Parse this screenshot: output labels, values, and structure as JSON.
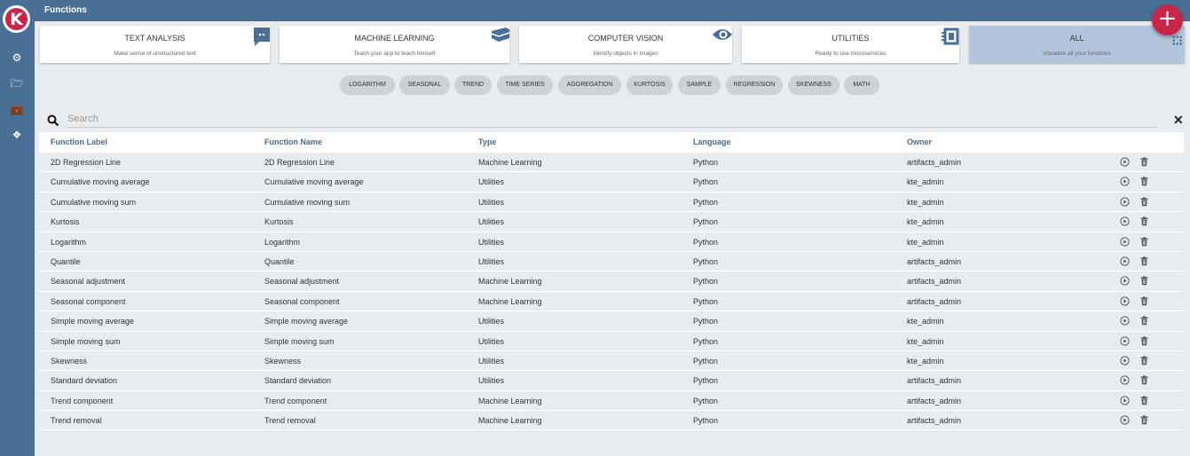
{
  "app": {
    "logo_letter": "K",
    "title": "Functions",
    "add_label": "+"
  },
  "sidebar": {
    "items": [
      {
        "icon": "gear-icon",
        "glyph": "⚙"
      },
      {
        "icon": "folder-open-icon",
        "glyph": "🗁"
      },
      {
        "icon": "briefcase-icon",
        "glyph": "💼"
      },
      {
        "icon": "cubes-icon",
        "glyph": "❖"
      }
    ]
  },
  "categories": [
    {
      "title": "TEXT ANALYSIS",
      "subtitle": "Make sense of unstructured text",
      "icon": "comment-icon"
    },
    {
      "title": "MACHINE LEARNING",
      "subtitle": "Teach your app to teach himself",
      "icon": "graduation-cap-icon"
    },
    {
      "title": "COMPUTER VISION",
      "subtitle": "Identify objects in images",
      "icon": "eye-icon"
    },
    {
      "title": "UTILITIES",
      "subtitle": "Ready to use microservices",
      "icon": "chip-icon"
    },
    {
      "title": "ALL",
      "subtitle": "Visualize all your functions",
      "icon": "grid-icon"
    }
  ],
  "tags": [
    "LOGARITHM",
    "SEASONAL",
    "TREND",
    "TIME SERIES",
    "AGGREGATION",
    "KURTOSIS",
    "SAMPLE",
    "REGRESSION",
    "SKEWNESS",
    "MATH"
  ],
  "search": {
    "placeholder": "Search",
    "value": ""
  },
  "table": {
    "columns": [
      "Function Label",
      "Function Name",
      "Type",
      "Language",
      "Owner"
    ],
    "rows": [
      [
        "2D Regression Line",
        "2D Regression Line",
        "Machine Learning",
        "Python",
        "artifacts_admin"
      ],
      [
        "Cumulative moving average",
        "Cumulative moving average",
        "Utilities",
        "Python",
        "kte_admin"
      ],
      [
        "Cumulative moving sum",
        "Cumulative moving sum",
        "Utilities",
        "Python",
        "kte_admin"
      ],
      [
        "Kurtosis",
        "Kurtosis",
        "Utilities",
        "Python",
        "kte_admin"
      ],
      [
        "Logarithm",
        "Logarithm",
        "Utilities",
        "Python",
        "kte_admin"
      ],
      [
        "Quantile",
        "Quantile",
        "Utilities",
        "Python",
        "artifacts_admin"
      ],
      [
        "Seasonal adjustment",
        "Seasonal adjustment",
        "Machine Learning",
        "Python",
        "artifacts_admin"
      ],
      [
        "Seasonal component",
        "Seasonal component",
        "Machine Learning",
        "Python",
        "artifacts_admin"
      ],
      [
        "Simple moving average",
        "Simple moving average",
        "Utilities",
        "Python",
        "kte_admin"
      ],
      [
        "Simple moving sum",
        "Simple moving sum",
        "Utilities",
        "Python",
        "kte_admin"
      ],
      [
        "Skewness",
        "Skewness",
        "Utilities",
        "Python",
        "kte_admin"
      ],
      [
        "Standard deviation",
        "Standard deviation",
        "Utilities",
        "Python",
        "artifacts_admin"
      ],
      [
        "Trend component",
        "Trend component",
        "Machine Learning",
        "Python",
        "artifacts_admin"
      ],
      [
        "Trend removal",
        "Trend removal",
        "Machine Learning",
        "Python",
        "artifacts_admin"
      ]
    ]
  },
  "colors": {
    "primary": "#4a6f95",
    "accent": "#c8254b",
    "header_text": "#4a6a88",
    "active_card": "#b2c5dc"
  }
}
